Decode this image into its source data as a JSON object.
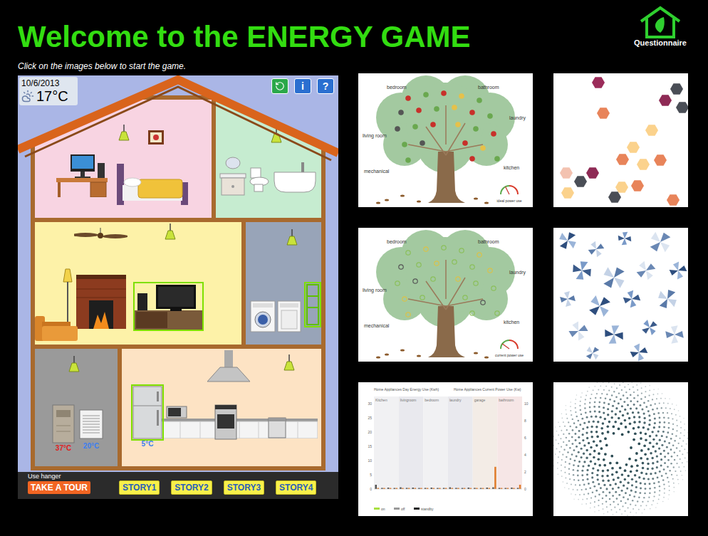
{
  "header": {
    "title": "Welcome to the ENERGY GAME",
    "instructions": "Click on the images below to start the game.",
    "questionnaire": "Questionnaire"
  },
  "house": {
    "date": "10/6/2013",
    "temperature": "17°C",
    "toolbar": [
      {
        "kind": "reset"
      },
      {
        "kind": "info",
        "label": "i"
      },
      {
        "kind": "help",
        "label": "?"
      }
    ],
    "rooms": [
      {
        "kind": "bedroom",
        "color": "#f8d4e2",
        "appliances": [
          {
            "kind": "lamp",
            "highlighted": false
          },
          {
            "kind": "frame",
            "highlighted": false
          },
          {
            "kind": "computer",
            "highlighted": false
          },
          {
            "kind": "bed",
            "highlighted": false
          }
        ]
      },
      {
        "kind": "bathroom",
        "color": "#c6ecd0",
        "appliances": [
          {
            "kind": "lamp",
            "highlighted": false
          },
          {
            "kind": "sink",
            "highlighted": false
          },
          {
            "kind": "toilet",
            "highlighted": false
          },
          {
            "kind": "bathtub",
            "highlighted": false
          }
        ]
      },
      {
        "kind": "living-room",
        "color": "#fdf2a8",
        "appliances": [
          {
            "kind": "fan",
            "highlighted": false
          },
          {
            "kind": "lamp",
            "highlighted": false
          },
          {
            "kind": "floor-lamp",
            "highlighted": false
          },
          {
            "kind": "fireplace",
            "highlighted": false
          },
          {
            "kind": "couch",
            "highlighted": false
          },
          {
            "kind": "tv",
            "highlighted": true
          }
        ]
      },
      {
        "kind": "laundry",
        "color": "#98a4b8",
        "appliances": [
          {
            "kind": "lamp",
            "highlighted": false
          },
          {
            "kind": "washer",
            "highlighted": false
          },
          {
            "kind": "dryer",
            "highlighted": false
          },
          {
            "kind": "rack",
            "highlighted": true
          }
        ]
      },
      {
        "kind": "mechanical",
        "color": "#9a9a9a",
        "appliances": [
          {
            "kind": "lamp",
            "highlighted": false
          },
          {
            "kind": "furnace",
            "highlighted": false,
            "reading": "37°C",
            "reading_color": "#e02020"
          },
          {
            "kind": "air-conditioner",
            "highlighted": false,
            "reading": "20°C",
            "reading_color": "#3c7ff0"
          }
        ]
      },
      {
        "kind": "kitchen",
        "color": "#fde3c4",
        "appliances": [
          {
            "kind": "hood",
            "highlighted": false
          },
          {
            "kind": "lamp",
            "highlighted": false
          },
          {
            "kind": "counter",
            "highlighted": false
          },
          {
            "kind": "microwave",
            "highlighted": false
          },
          {
            "kind": "stove",
            "highlighted": false
          },
          {
            "kind": "dishwasher",
            "highlighted": false
          },
          {
            "kind": "fridge",
            "highlighted": true,
            "reading": "5°C",
            "reading_color": "#3c7ff0"
          }
        ]
      }
    ],
    "hint": "Use hanger",
    "tour": "TAKE A TOUR",
    "stories": [
      "STORY1",
      "STORY2",
      "STORY3",
      "STORY4"
    ]
  },
  "thumbnails": [
    {
      "kind": "tree",
      "labels": [
        "bedroom",
        "bathroom",
        "living room",
        "laundry",
        "mechanical",
        "kitchen"
      ],
      "gauge": {
        "label": "ideal power use",
        "level": 0.35
      },
      "apples": [
        {
          "color": "#c8302a",
          "filled": true
        },
        {
          "color": "#6aa84f",
          "filled": true
        },
        {
          "color": "#c8302a",
          "filled": true
        },
        {
          "color": "#e6c14a",
          "filled": true
        },
        {
          "color": "#6aa84f",
          "filled": true
        },
        {
          "color": "#555555",
          "filled": true
        },
        {
          "color": "#c8302a",
          "filled": true
        },
        {
          "color": "#6aa84f",
          "filled": true
        },
        {
          "color": "#e6c14a",
          "filled": true
        },
        {
          "color": "#c8302a",
          "filled": true
        },
        {
          "color": "#6aa84f",
          "filled": true
        },
        {
          "color": "#555555",
          "filled": true
        },
        {
          "color": "#6aa84f",
          "filled": true
        },
        {
          "color": "#c8302a",
          "filled": true
        },
        {
          "color": "#e6c14a",
          "filled": true
        },
        {
          "color": "#6aa84f",
          "filled": true
        },
        {
          "color": "#c8302a",
          "filled": true
        },
        {
          "color": "#6aa84f",
          "filled": true
        },
        {
          "color": "#555555",
          "filled": true
        },
        {
          "color": "#c8302a",
          "filled": true
        },
        {
          "color": "#e6c14a",
          "filled": true
        },
        {
          "color": "#6aa84f",
          "filled": true
        },
        {
          "color": "#c8302a",
          "filled": true
        },
        {
          "color": "#6aa84f",
          "filled": true
        }
      ]
    },
    {
      "kind": "hexagons"
    },
    {
      "kind": "tree",
      "labels": [
        "bedroom",
        "bathroom",
        "living room",
        "laundry",
        "mechanical",
        "kitchen"
      ],
      "gauge": {
        "label": "current power use",
        "level": 0.2
      },
      "apples": [
        {
          "color": "#8bbf5a",
          "filled": false
        },
        {
          "color": "#d9c24a",
          "filled": false
        },
        {
          "color": "#8bbf5a",
          "filled": false
        },
        {
          "color": "#8bbf5a",
          "filled": false
        },
        {
          "color": "#d9c24a",
          "filled": false
        },
        {
          "color": "#555555",
          "filled": false
        },
        {
          "color": "#8bbf5a",
          "filled": false
        },
        {
          "color": "#d9c24a",
          "filled": false
        },
        {
          "color": "#8bbf5a",
          "filled": false
        },
        {
          "color": "#8bbf5a",
          "filled": false
        },
        {
          "color": "#d9c24a",
          "filled": false
        },
        {
          "color": "#8bbf5a",
          "filled": false
        },
        {
          "color": "#555555",
          "filled": false
        },
        {
          "color": "#8bbf5a",
          "filled": false
        },
        {
          "color": "#d9c24a",
          "filled": false
        },
        {
          "color": "#8bbf5a",
          "filled": false
        },
        {
          "color": "#8bbf5a",
          "filled": false
        },
        {
          "color": "#d9c24a",
          "filled": false
        },
        {
          "color": "#8bbf5a",
          "filled": false
        },
        {
          "color": "#8bbf5a",
          "filled": false
        },
        {
          "color": "#555555",
          "filled": false
        },
        {
          "color": "#d9c24a",
          "filled": false
        },
        {
          "color": "#8bbf5a",
          "filled": false
        },
        {
          "color": "#8bbf5a",
          "filled": false
        }
      ]
    },
    {
      "kind": "pinwheels"
    },
    {
      "kind": "chart",
      "title_left": "Home Appliances Day Energy Use (Kwh)",
      "title_right": "Home Appliances Current Power Use (Kw)",
      "sections": [
        "Kitchen",
        "livingroom",
        "bedroom",
        "laundry",
        "garage",
        "bathroom"
      ],
      "left_ticks": [
        "30",
        "25",
        "20",
        "15",
        "10",
        "5",
        "0"
      ],
      "right_ticks": [
        "10",
        "8",
        "6",
        "4",
        "2",
        "0"
      ],
      "series": [
        {
          "name": "day",
          "axis": "left",
          "color": "#555555",
          "values": [
            1.5,
            0.4,
            0.5,
            0.3,
            0.6,
            0.4,
            0.5,
            0.3,
            0.4,
            0.5,
            0.3,
            0.4,
            0.6,
            0.4,
            0.3,
            0.5,
            0.4,
            0.3,
            0.5,
            0.6,
            0.4,
            0.3,
            0.5,
            0.4
          ]
        },
        {
          "name": "current",
          "axis": "right",
          "color": "#e07b2a",
          "values": [
            0.1,
            0.05,
            0.05,
            0.05,
            0.05,
            0.05,
            0.05,
            0.05,
            0.05,
            0.05,
            0.05,
            0.05,
            0.05,
            0.05,
            0.05,
            0.05,
            0.05,
            0.05,
            0.05,
            2.6,
            0.05,
            0.05,
            0.05,
            0.5
          ]
        }
      ],
      "legend": [
        {
          "label": "on",
          "color": "#a8e040"
        },
        {
          "label": "off",
          "color": "#999999"
        },
        {
          "label": "standby",
          "color": "#222222"
        }
      ]
    },
    {
      "kind": "spiral"
    }
  ]
}
